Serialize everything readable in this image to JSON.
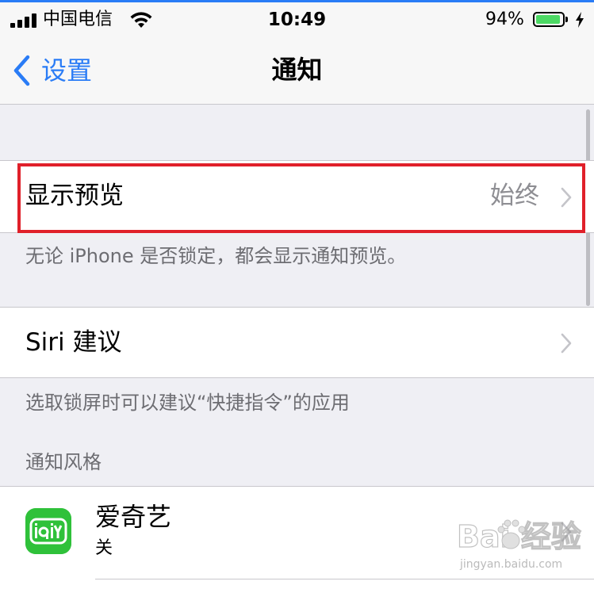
{
  "status_bar": {
    "carrier": "中国电信",
    "time": "10:49",
    "battery_percent": "94%",
    "battery_level": 0.94
  },
  "nav": {
    "back_label": "设置",
    "title": "通知"
  },
  "show_preview": {
    "label": "显示预览",
    "value": "始终",
    "footer": "无论 iPhone 是否锁定，都会显示通知预览。"
  },
  "siri": {
    "label": "Siri 建议",
    "footer": "选取锁屏时可以建议“快捷指令”的应用"
  },
  "notification_style": {
    "header": "通知风格",
    "apps": [
      {
        "name": "爱奇艺",
        "status": "关",
        "icon": "iqiyi-app-icon"
      }
    ]
  },
  "colors": {
    "accent": "#2a7cf6",
    "highlight": "#e0202a",
    "battery": "#4cd964"
  },
  "watermark": {
    "text": "Bai 经验",
    "url": "jingyan.baidu.com"
  }
}
